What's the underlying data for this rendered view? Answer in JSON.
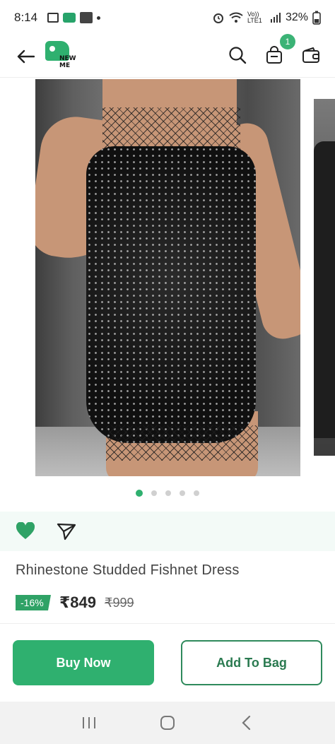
{
  "status_bar": {
    "time": "8:14",
    "network": "Vo)) LTE1",
    "battery": "32%"
  },
  "header": {
    "logo_text_line1": "NEW",
    "logo_text_line2": "ME",
    "bag_count": "1"
  },
  "gallery": {
    "image_count": 5,
    "active_index": 0
  },
  "product": {
    "title": "Rhinestone Studded Fishnet Dress",
    "discount": "-16%",
    "price": "₹849",
    "mrp": "₹999"
  },
  "actions": {
    "buy_now": "Buy Now",
    "add_to_bag": "Add To Bag"
  },
  "colors": {
    "accent": "#2fb06f",
    "wishlist": "#2fa266"
  },
  "icons": {
    "back": "arrow-left-icon",
    "search": "search-icon",
    "bag": "shopping-bag-icon",
    "wallet": "wallet-icon",
    "wishlist": "heart-icon",
    "share": "send-icon"
  }
}
